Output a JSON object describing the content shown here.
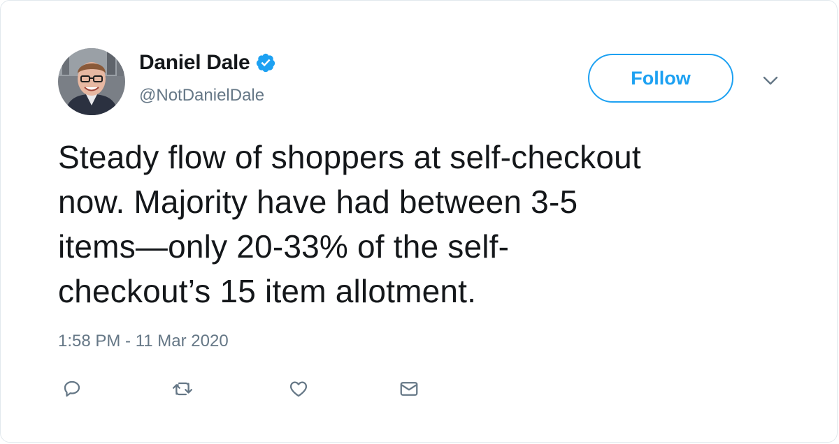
{
  "tweet": {
    "author": {
      "display_name": "Daniel Dale",
      "handle": "@NotDanielDale",
      "verified": true,
      "avatar_icon": "profile-photo"
    },
    "follow_label": "Follow",
    "menu_icon": "chevron-down-icon",
    "text": "Steady flow of shoppers at self-checkout\nnow. Majority have had between 3-5\nitems—only 20-33% of the self-\ncheckout’s 15 item allotment.",
    "timestamp": "1:58 PM - 11 Mar 2020",
    "actions": [
      {
        "icon": "reply-icon"
      },
      {
        "icon": "retweet-icon"
      },
      {
        "icon": "like-icon"
      },
      {
        "icon": "message-icon"
      }
    ]
  },
  "colors": {
    "accent": "#1da1f2",
    "text_primary": "#14171a",
    "text_secondary": "#657786",
    "border": "#e1e8ed"
  }
}
